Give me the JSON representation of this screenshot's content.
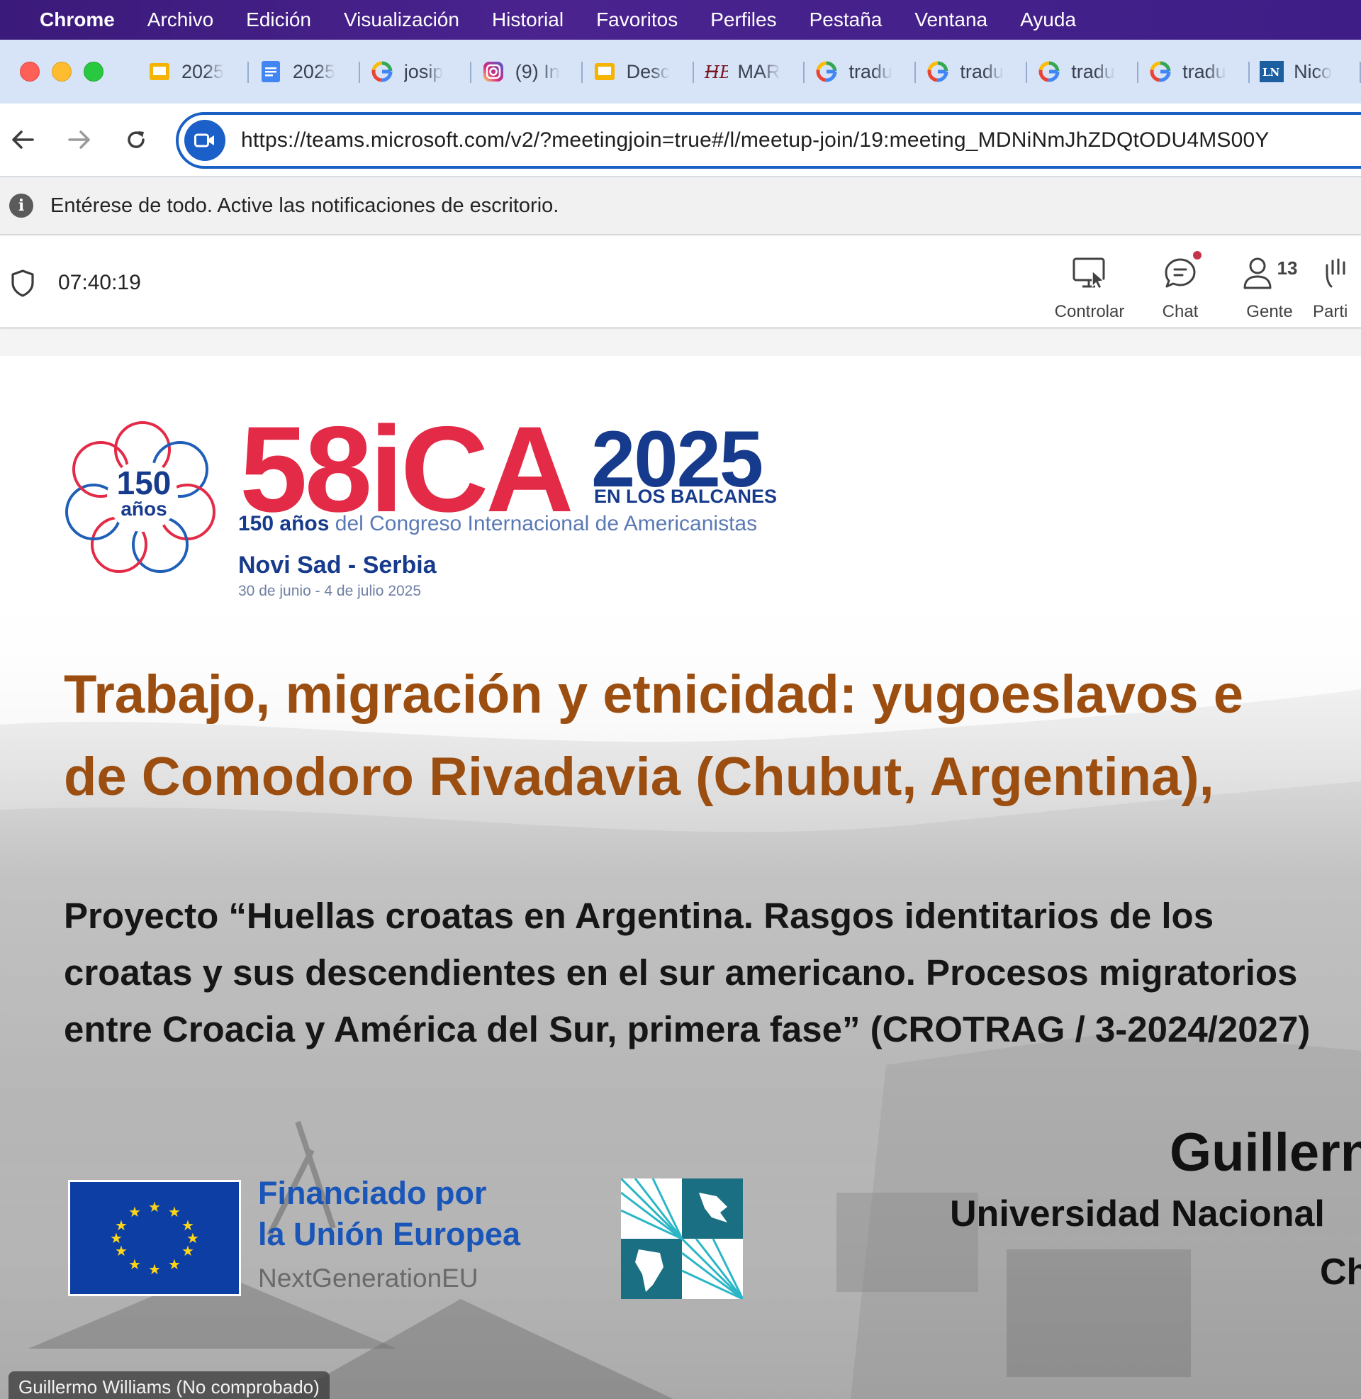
{
  "menubar": {
    "app": "Chrome",
    "items": [
      "Archivo",
      "Edición",
      "Visualización",
      "Historial",
      "Favoritos",
      "Perfiles",
      "Pestaña",
      "Ventana",
      "Ayuda"
    ]
  },
  "tabs": [
    {
      "title": "2025",
      "icon": "slides-icon"
    },
    {
      "title": "2025",
      "icon": "docs-icon"
    },
    {
      "title": "josip",
      "icon": "google-icon"
    },
    {
      "title": "(9) In",
      "icon": "instagram-icon"
    },
    {
      "title": "Desc",
      "icon": "slides-icon"
    },
    {
      "title": "MAR",
      "icon": "hb-icon"
    },
    {
      "title": "tradu",
      "icon": "google-icon"
    },
    {
      "title": "tradu",
      "icon": "google-icon"
    },
    {
      "title": "tradu",
      "icon": "google-icon"
    },
    {
      "title": "tradu",
      "icon": "google-icon"
    },
    {
      "title": "Nico",
      "icon": "ln-icon"
    }
  ],
  "address": {
    "url": "https://teams.microsoft.com/v2/?meetingjoin=true#/l/meetup-join/19:meeting_MDNiNmJhZDQtODU4MS00Y"
  },
  "infobar": {
    "text": "Entérese de todo. Active las notificaciones de escritorio."
  },
  "meeting": {
    "timer": "07:40:19",
    "controls": {
      "control": "Controlar",
      "chat": "Chat",
      "people": "Gente",
      "people_count": "13",
      "participate": "Parti"
    }
  },
  "slide": {
    "logo_main": "58iCA",
    "logo_year": "2025",
    "logo_balkans": "EN LOS BALCANES",
    "logo_badge_number": "150",
    "logo_badge_word": "años",
    "logo_sub_bold": "150 años",
    "logo_sub_rest": " del Congreso Internacional de Americanistas",
    "logo_city": "Novi Sad - Serbia",
    "logo_dates": "30 de junio - 4 de julio 2025",
    "title_line1": "Trabajo, migración y etnicidad: yugoeslavos e",
    "title_line2": "de Comodoro Rivadavia (Chubut, Argentina),",
    "project": "Proyecto “Huellas croatas en Argentina. Rasgos identitarios de los croatas y sus descendientes en el sur americano. Procesos migratorios entre Croacia y América del Sur, primera fase” (CROTRAG / 3-2024/2027)",
    "eu_line1": "Financiado por",
    "eu_line2": "la Unión Europea",
    "eu_line3": "NextGenerationEU",
    "speaker_name": "Guillern",
    "speaker_university": "Universidad Nacional",
    "speaker_city": "Ch"
  },
  "participant_label": "Guillermo Williams (No comprobado)",
  "colors": {
    "menubar": "#3a1a7a",
    "tabstrip": "#d7e3f6",
    "omnibox_border": "#1a5fc4",
    "title_brown": "#9c4e10",
    "ica_red": "#e32a46",
    "ica_blue": "#173b8c",
    "eu_blue": "#0d3ea3"
  }
}
